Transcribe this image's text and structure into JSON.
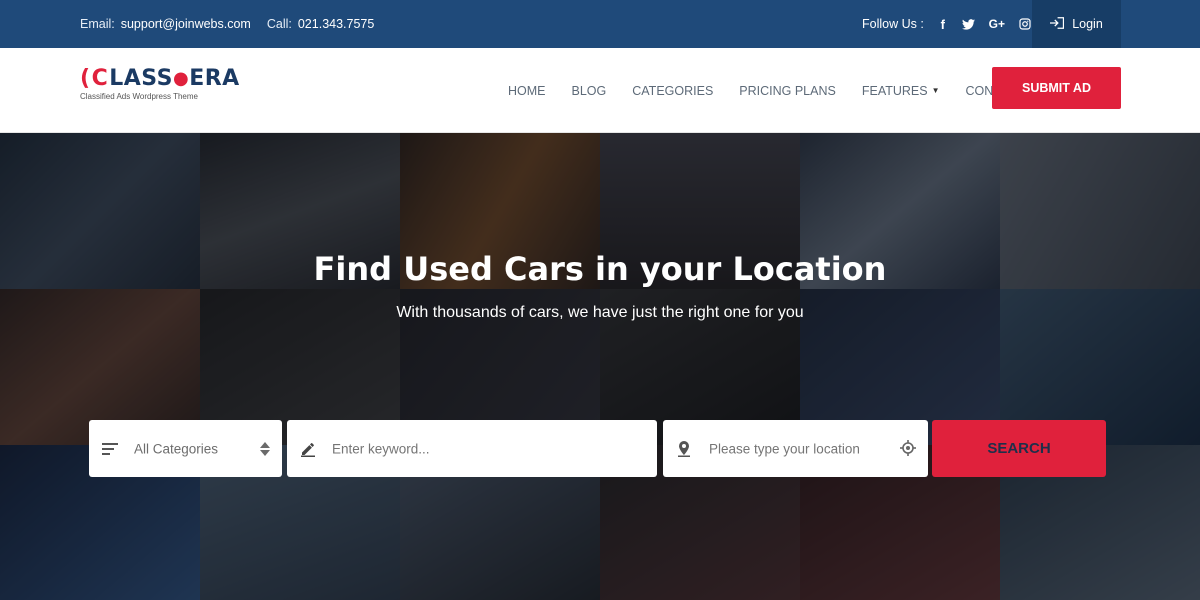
{
  "topbar": {
    "email_label": "Email:",
    "email_value": "support@joinwebs.com",
    "call_label": "Call:",
    "call_value": "021.343.7575",
    "follow_label": "Follow Us :",
    "social_icons": [
      "facebook-icon",
      "twitter-icon",
      "google-plus-icon",
      "instagram-icon"
    ],
    "login_label": "Login"
  },
  "logo": {
    "brand": "CLASSIERA",
    "tagline": "Classified Ads Wordpress Theme"
  },
  "nav": {
    "items": [
      "HOME",
      "BLOG",
      "CATEGORIES",
      "PRICING PLANS",
      "FEATURES",
      "CONTACT"
    ],
    "submit_label": "SUBMIT AD"
  },
  "hero": {
    "title": "Find Used Cars in your Location",
    "subtitle": "With thousands of cars, we have just the right one for you"
  },
  "search": {
    "category_value": "All Categories",
    "keyword_placeholder": "Enter keyword...",
    "location_placeholder": "Please type your location",
    "search_label": "SEARCH"
  },
  "colors": {
    "topbar_bg": "#1f4a7a",
    "accent_red": "#e0213c",
    "nav_text": "#5d6a78"
  }
}
